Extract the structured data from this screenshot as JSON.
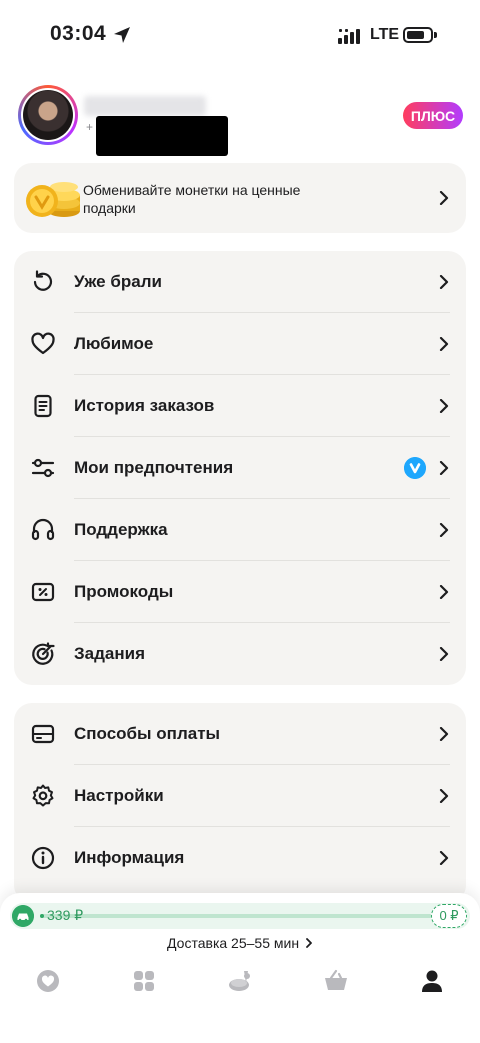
{
  "status_bar": {
    "time": "03:04",
    "network": "LTE"
  },
  "profile": {
    "plus_badge": "ПЛЮС",
    "phone_prefix": "+"
  },
  "coins_card": {
    "text": "Обменивайте монетки на ценные подарки"
  },
  "menu_group_1": [
    {
      "label": "Уже брали",
      "icon": "history-icon"
    },
    {
      "label": "Любимое",
      "icon": "heart-icon"
    },
    {
      "label": "История заказов",
      "icon": "receipt-icon"
    },
    {
      "label": "Мои предпочтения",
      "icon": "sliders-icon"
    },
    {
      "label": "Поддержка",
      "icon": "headset-icon"
    },
    {
      "label": "Промокоды",
      "icon": "promo-icon"
    },
    {
      "label": "Задания",
      "icon": "target-icon"
    }
  ],
  "menu_group_2": [
    {
      "label": "Способы оплаты",
      "icon": "card-icon"
    },
    {
      "label": "Настройки",
      "icon": "gear-icon"
    },
    {
      "label": "Информация",
      "icon": "info-icon"
    }
  ],
  "delivery_bar": {
    "amount": "339 ₽",
    "free_amount": "0 ₽",
    "progress": 0.01,
    "delivery_text": "Доставка 25–55 мин"
  },
  "tabs": [
    {
      "icon": "heart-logo-icon",
      "active": false
    },
    {
      "icon": "catalog-icon",
      "active": false
    },
    {
      "icon": "food-icon",
      "active": false
    },
    {
      "icon": "basket-icon",
      "active": false
    },
    {
      "icon": "profile-icon",
      "active": true
    }
  ],
  "colors": {
    "accent_green": "#2fa866",
    "badge_blue": "#1ea7fd",
    "plus_gradient_start": "#ff3d5e",
    "plus_gradient_end": "#b23cff"
  }
}
